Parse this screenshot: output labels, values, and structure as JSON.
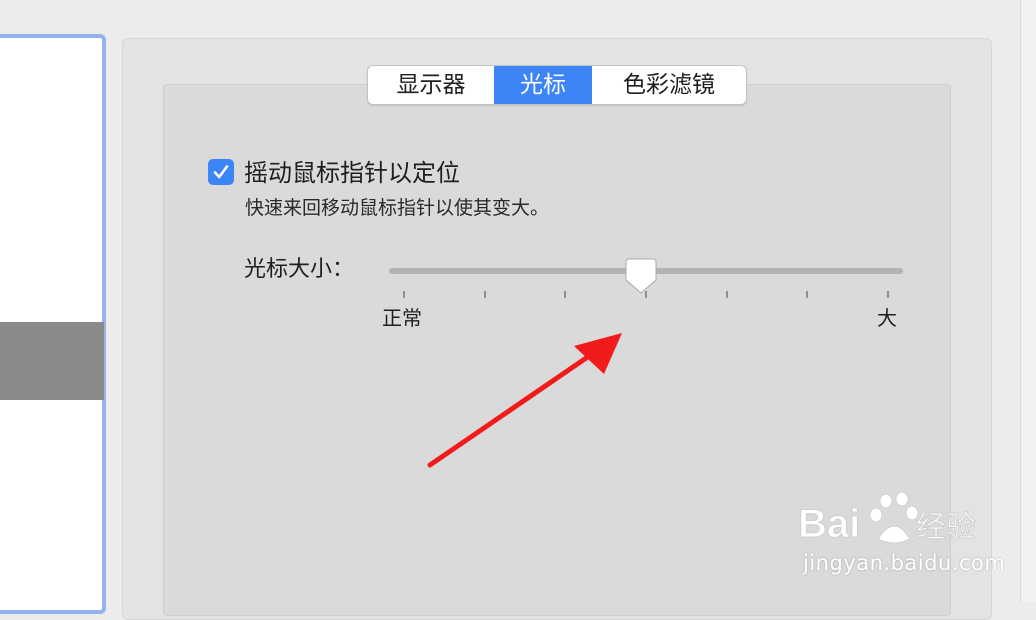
{
  "tabs": [
    {
      "label": "显示器",
      "active": false
    },
    {
      "label": "光标",
      "active": true
    },
    {
      "label": "色彩滤镜",
      "active": false
    }
  ],
  "shake_option": {
    "label": "摇动鼠标指针以定位",
    "description": "快速来回移动鼠标指针以使其变大。",
    "checked": true
  },
  "cursor_size": {
    "label": "光标大小：",
    "min_label": "正常",
    "max_label": "大",
    "tick_count": 7,
    "value_fraction": 0.5
  },
  "watermark": {
    "logo_text": "Bai du 经验",
    "url_text": "jingyan.baidu.com"
  },
  "colors": {
    "accent": "#3d84f6",
    "annotation_arrow": "#f21b1b"
  },
  "icons": {
    "checkbox": "checkmark-icon",
    "annotation": "red-arrow-icon",
    "watermark": "baidu-paw-icon"
  }
}
